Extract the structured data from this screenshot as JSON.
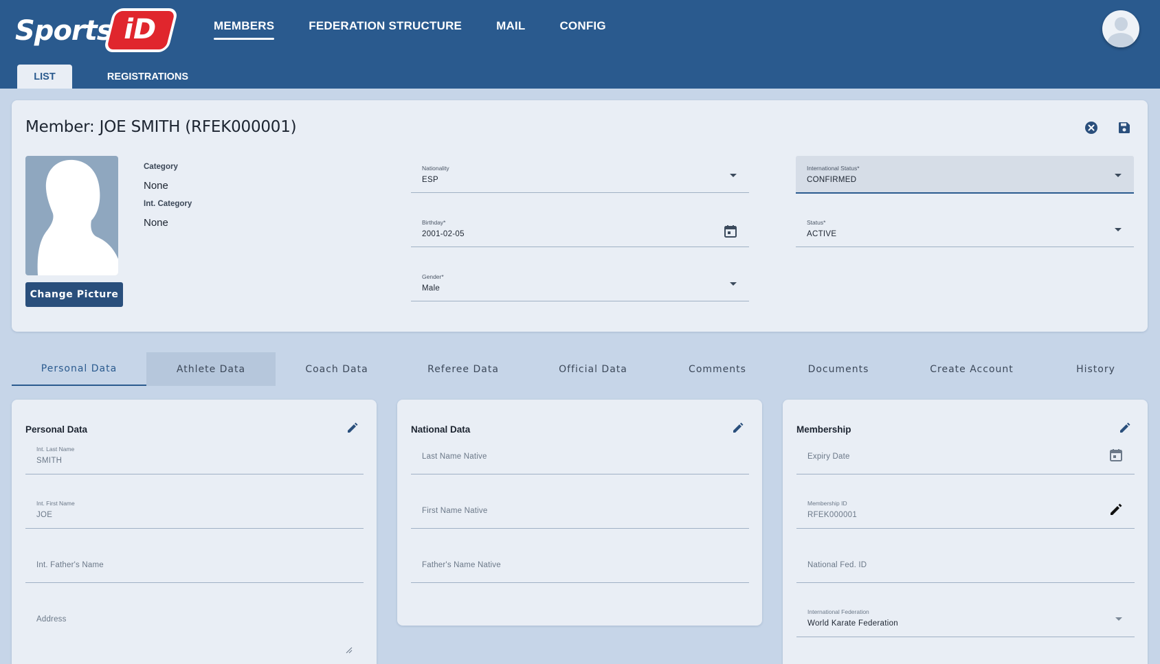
{
  "header": {
    "logo_text": "Sports",
    "logo_badge": "iD",
    "nav": [
      {
        "label": "MEMBERS",
        "active": true
      },
      {
        "label": "FEDERATION STRUCTURE",
        "active": false
      },
      {
        "label": "MAIL",
        "active": false
      },
      {
        "label": "CONFIG",
        "active": false
      }
    ],
    "subtabs": [
      {
        "label": "LIST",
        "active": true
      },
      {
        "label": "REGISTRATIONS",
        "active": false
      }
    ]
  },
  "member": {
    "title": "Member: JOE SMITH (RFEK000001)",
    "category_label": "Category",
    "category_value": "None",
    "int_category_label": "Int. Category",
    "int_category_value": "None",
    "change_picture": "Change Picture",
    "nationality": {
      "label": "Nationality",
      "value": "ESP"
    },
    "birthday": {
      "label": "Birthday*",
      "value": "2001-02-05"
    },
    "gender": {
      "label": "Gender*",
      "value": "Male"
    },
    "international_status": {
      "label": "International Status*",
      "value": "CONFIRMED"
    },
    "status": {
      "label": "Status*",
      "value": "ACTIVE"
    }
  },
  "tabs": [
    {
      "label": "Personal Data",
      "active": true
    },
    {
      "label": "Athlete Data",
      "hover": true
    },
    {
      "label": "Coach Data"
    },
    {
      "label": "Referee Data"
    },
    {
      "label": "Official Data"
    },
    {
      "label": "Comments"
    },
    {
      "label": "Documents"
    },
    {
      "label": "Create Account"
    },
    {
      "label": "History"
    }
  ],
  "personal": {
    "title": "Personal Data",
    "int_last_name": {
      "label": "Int. Last Name",
      "value": "SMITH"
    },
    "int_first_name": {
      "label": "Int. First Name",
      "value": "JOE"
    },
    "int_father_name_placeholder": "Int. Father's Name",
    "address_placeholder": "Address"
  },
  "national": {
    "title": "National Data",
    "last_name_native_placeholder": "Last Name Native",
    "first_name_native_placeholder": "First Name Native",
    "father_name_native_placeholder": "Father's Name Native"
  },
  "membership": {
    "title": "Membership",
    "expiry_placeholder": "Expiry Date",
    "membership_id": {
      "label": "Membership ID",
      "value": "RFEK000001"
    },
    "national_fed_placeholder": "National Fed. ID",
    "int_federation": {
      "label": "International Federation",
      "value": "World Karate Federation"
    }
  },
  "colors": {
    "header_bg": "#2a5a8e",
    "page_bg": "#c6d5e8",
    "card_bg": "#e9eef5",
    "accent": "#2a5a8e",
    "button_bg": "#2a4f7c"
  }
}
